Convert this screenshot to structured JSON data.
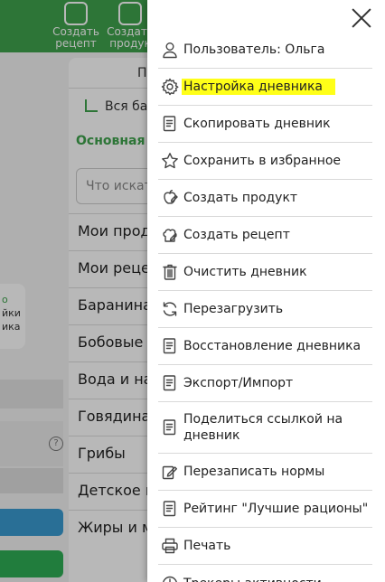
{
  "background": {
    "topbar": {
      "buttons": [
        {
          "label_line1": "Создать",
          "label_line2": "рецепт"
        },
        {
          "label_line1": "Создать",
          "label_line2": "продук"
        }
      ]
    },
    "left_card": {
      "line1": "о",
      "line2": "йки",
      "line3": "ика"
    },
    "help_glyph": "?",
    "panel": {
      "header": "По",
      "all_bases": "Вся ба",
      "main_tab": "Основная",
      "search_placeholder": "Что искат",
      "categories": [
        "Мои прод",
        "Мои рецеп",
        "Баранина",
        "Бобовые",
        "Вода и на",
        "Говядина",
        "Грибы",
        "Детское п",
        "Жиры и м"
      ]
    }
  },
  "menu": {
    "close_icon": "close-icon",
    "items": [
      {
        "label": "Пользователь: Ольга",
        "icon": "user-icon",
        "highlight": false
      },
      {
        "label": "Настройка дневника",
        "icon": "gear-icon",
        "highlight": true
      },
      {
        "label": "Скопировать дневник",
        "icon": "document-icon",
        "highlight": false
      },
      {
        "label": "Сохранить в избранное",
        "icon": "star-icon",
        "highlight": false
      },
      {
        "label": "Создать продукт",
        "icon": "apple-edit-icon",
        "highlight": false
      },
      {
        "label": "Создать рецепт",
        "icon": "chef-hat-edit-icon",
        "highlight": false
      },
      {
        "label": "Очистить дневник",
        "icon": "trash-icon",
        "highlight": false
      },
      {
        "label": "Перезагрузить",
        "icon": "refresh-icon",
        "highlight": false
      },
      {
        "label": "Восстановление дневника",
        "icon": "document-icon",
        "highlight": false
      },
      {
        "label": "Экспорт/Импорт",
        "icon": "document-icon",
        "highlight": false
      },
      {
        "label": "Поделиться ссылкой на дневник",
        "icon": "document-icon",
        "highlight": false
      },
      {
        "label": "Перезаписать нормы",
        "icon": "edit-icon",
        "highlight": false
      },
      {
        "label": "Рейтинг \"Лучшие рационы\"",
        "icon": "document-icon",
        "highlight": false
      },
      {
        "label": "Печать",
        "icon": "printer-icon",
        "highlight": false
      },
      {
        "label": "Трекеры активности",
        "icon": "tracker-icon",
        "highlight": false
      }
    ]
  },
  "colors": {
    "brand_green": "#3fa34d",
    "highlight": "#ffff18"
  }
}
